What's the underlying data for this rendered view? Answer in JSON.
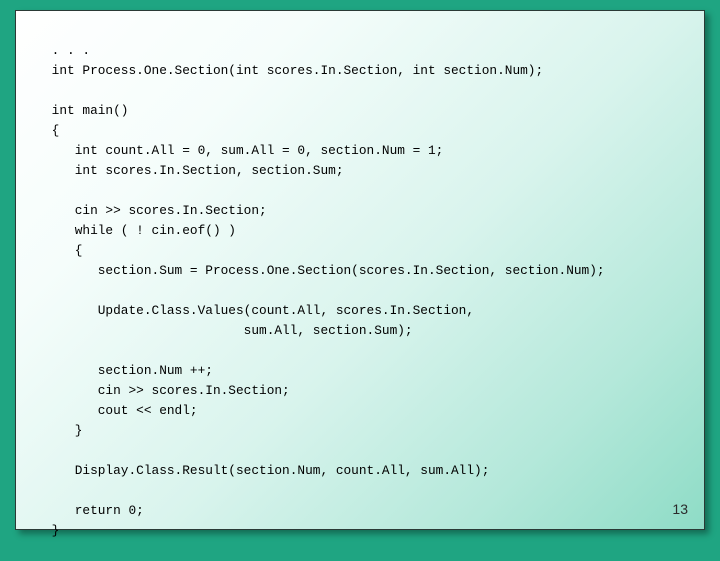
{
  "slide": {
    "lines": {
      "l0": " . . .",
      "l1": " int Process.One.Section(int scores.In.Section, int section.Num);",
      "l2": "",
      "l3": " int main()",
      "l4": " {",
      "l5": "    int count.All = 0, sum.All = 0, section.Num = 1;",
      "l6": "    int scores.In.Section, section.Sum;",
      "l7": "",
      "l8": "    cin >> scores.In.Section;",
      "l9": "    while ( ! cin.eof() )",
      "l10": "    {",
      "l11": "       section.Sum = Process.One.Section(scores.In.Section, section.Num);",
      "l12": "",
      "l13": "       Update.Class.Values(count.All, scores.In.Section,",
      "l14": "                          sum.All, section.Sum);",
      "l15": "",
      "l16": "       section.Num ++;",
      "l17": "       cin >> scores.In.Section;",
      "l18": "       cout << endl;",
      "l19": "    }",
      "l20": "",
      "l21": "    Display.Class.Result(section.Num, count.All, sum.All);",
      "l22": "",
      "l23": "    return 0;",
      "l24": " }"
    },
    "page_number": "13"
  }
}
